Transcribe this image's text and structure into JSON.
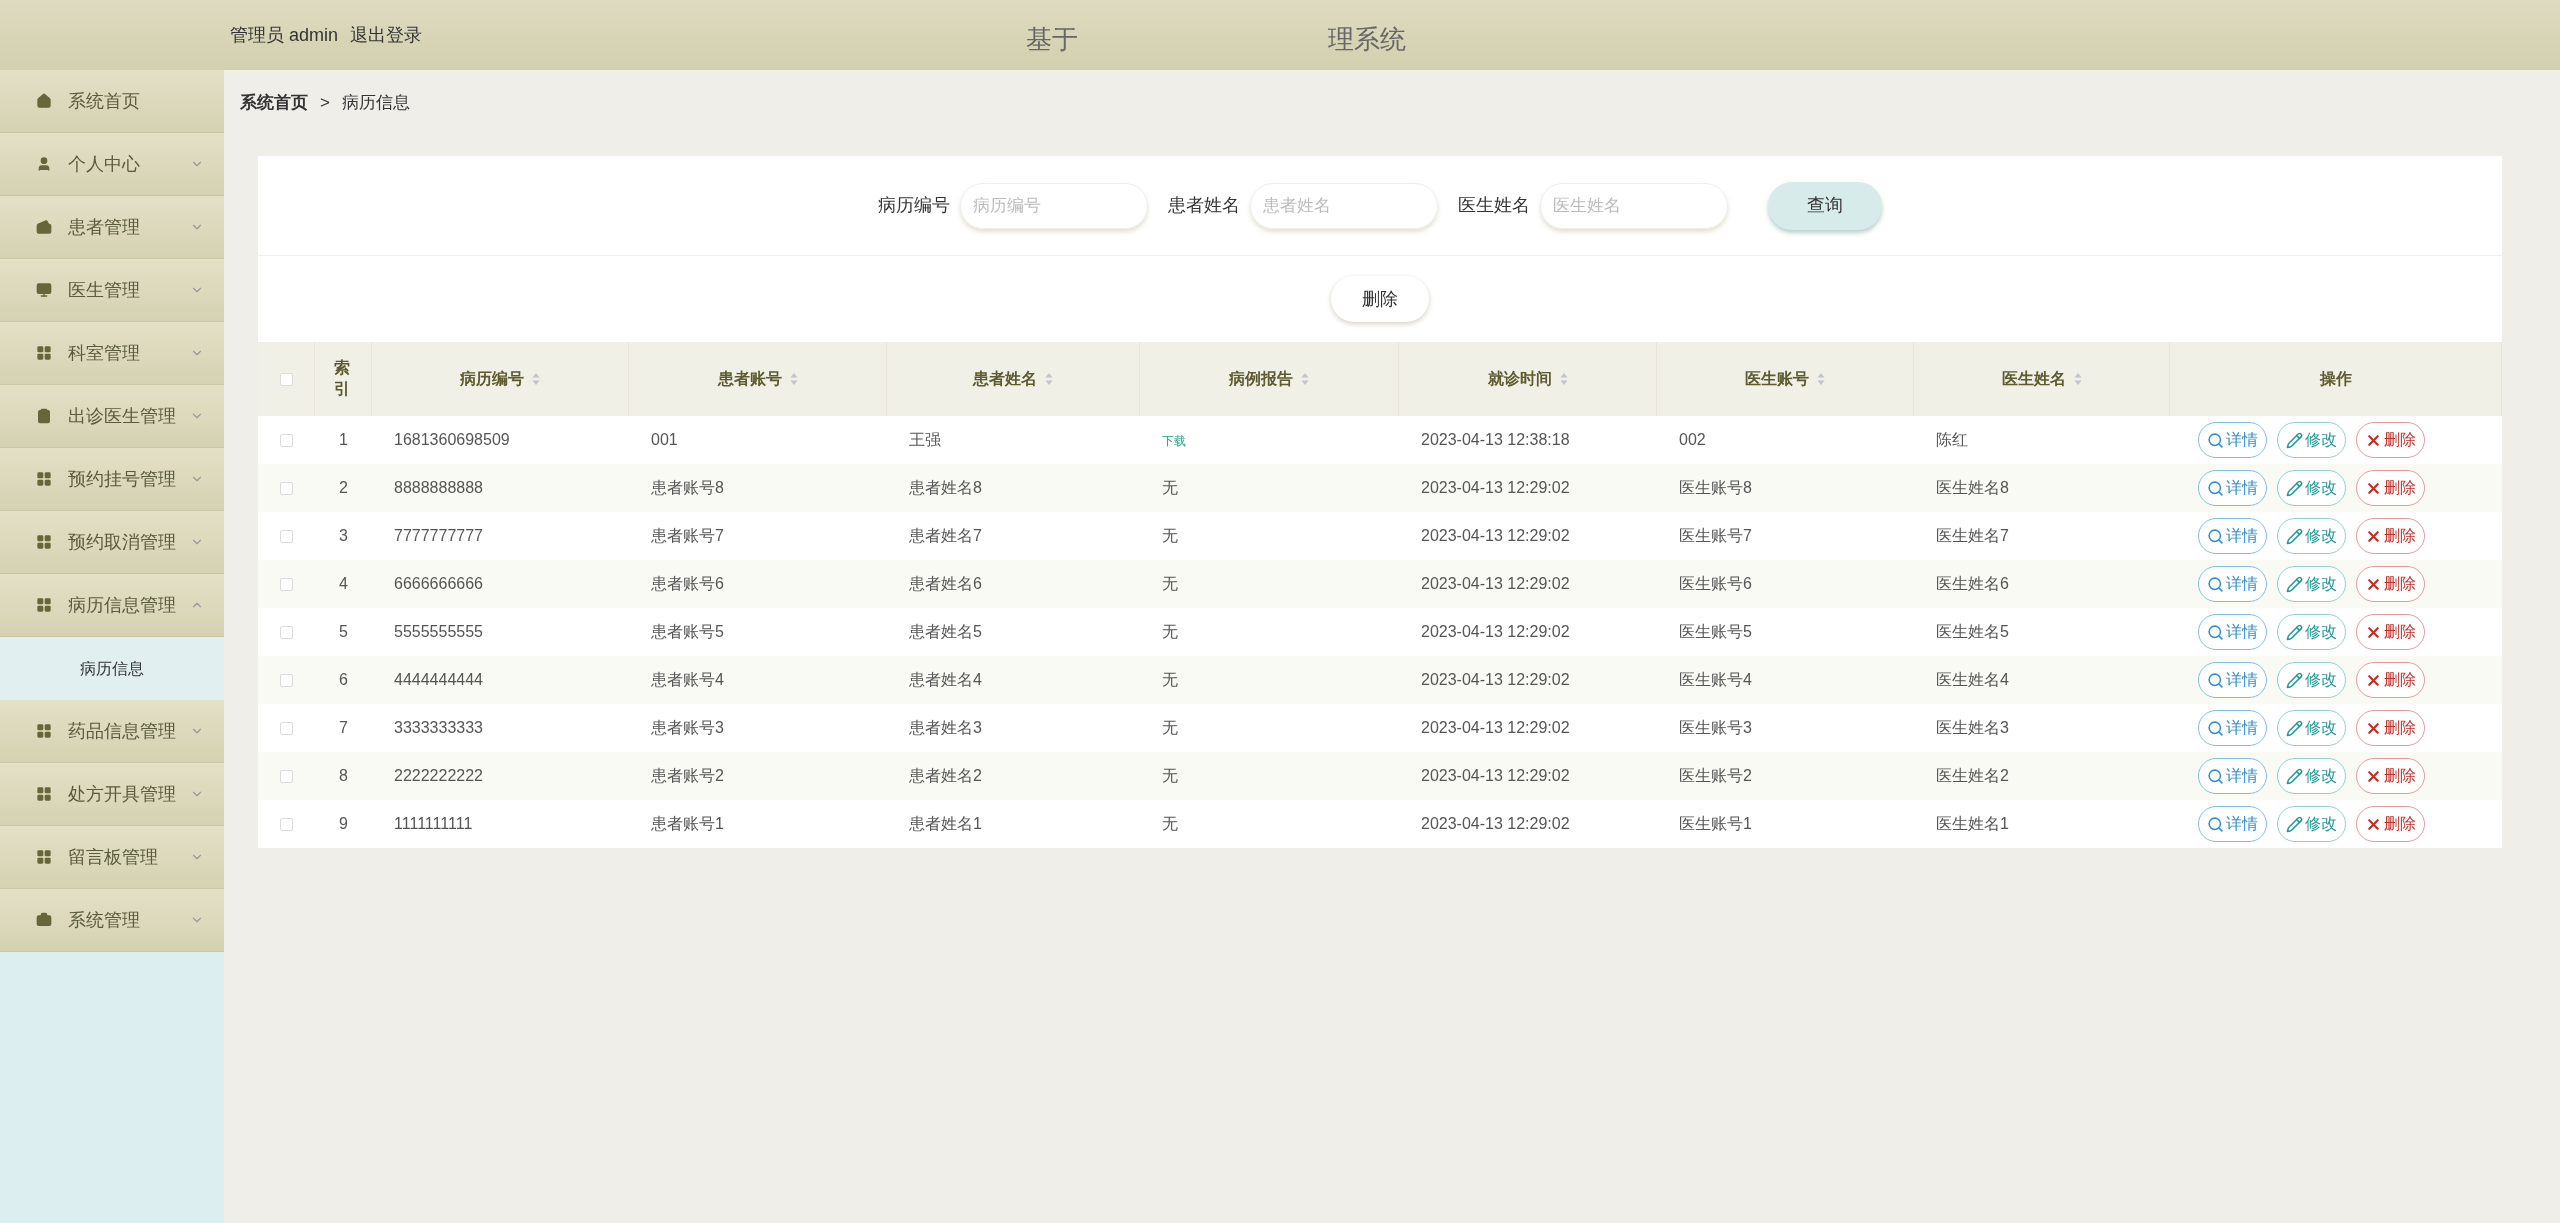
{
  "header": {
    "user": "管理员 admin",
    "logout": "退出登录",
    "title_start": "基于",
    "title_end": "理系统"
  },
  "sidebar": {
    "items": [
      {
        "label": "系统首页",
        "expandable": false,
        "expanded": false
      },
      {
        "label": "个人中心",
        "expandable": true,
        "expanded": false
      },
      {
        "label": "患者管理",
        "expandable": true,
        "expanded": false
      },
      {
        "label": "医生管理",
        "expandable": true,
        "expanded": false
      },
      {
        "label": "科室管理",
        "expandable": true,
        "expanded": false
      },
      {
        "label": "出诊医生管理",
        "expandable": true,
        "expanded": false
      },
      {
        "label": "预约挂号管理",
        "expandable": true,
        "expanded": false
      },
      {
        "label": "预约取消管理",
        "expandable": true,
        "expanded": false
      },
      {
        "label": "病历信息管理",
        "expandable": true,
        "expanded": true,
        "children": [
          {
            "label": "病历信息",
            "selected": true
          }
        ]
      },
      {
        "label": "药品信息管理",
        "expandable": true,
        "expanded": false
      },
      {
        "label": "处方开具管理",
        "expandable": true,
        "expanded": false
      },
      {
        "label": "留言板管理",
        "expandable": true,
        "expanded": false
      },
      {
        "label": "系统管理",
        "expandable": true,
        "expanded": false
      }
    ]
  },
  "breadcrumb": [
    "系统首页",
    ">",
    "病历信息"
  ],
  "search": {
    "fields": [
      {
        "label": "病历编号",
        "placeholder": "病历编号"
      },
      {
        "label": "患者姓名",
        "placeholder": "患者姓名"
      },
      {
        "label": "医生姓名",
        "placeholder": "医生姓名"
      }
    ],
    "button": "查询"
  },
  "toolbar": {
    "delete": "删除"
  },
  "table": {
    "select_all_checked": false,
    "columns": [
      {
        "label": "索引",
        "sortable": false
      },
      {
        "label": "病历编号",
        "sortable": true
      },
      {
        "label": "患者账号",
        "sortable": true
      },
      {
        "label": "患者姓名",
        "sortable": true
      },
      {
        "label": "病例报告",
        "sortable": true
      },
      {
        "label": "就诊时间",
        "sortable": true
      },
      {
        "label": "医生账号",
        "sortable": true
      },
      {
        "label": "医生姓名",
        "sortable": true
      },
      {
        "label": "操作",
        "sortable": false
      }
    ],
    "rows": [
      {
        "checked": false,
        "cells": [
          "1",
          "1681360698509",
          "001",
          "王强",
          {
            "kind": "link",
            "text": "下载"
          },
          "2023-04-13 12:38:18",
          "002",
          "陈红"
        ],
        "actions": [
          {
            "kind": "view",
            "label": "详情"
          },
          {
            "kind": "edit",
            "label": "修改"
          },
          {
            "kind": "delete",
            "label": "删除"
          }
        ]
      },
      {
        "checked": false,
        "cells": [
          "2",
          "8888888888",
          "患者账号8",
          "患者姓名8",
          {
            "kind": "text",
            "text": "无"
          },
          "2023-04-13 12:29:02",
          "医生账号8",
          "医生姓名8"
        ],
        "actions": [
          {
            "kind": "view",
            "label": "详情"
          },
          {
            "kind": "edit",
            "label": "修改"
          },
          {
            "kind": "delete",
            "label": "删除"
          }
        ]
      },
      {
        "checked": false,
        "cells": [
          "3",
          "7777777777",
          "患者账号7",
          "患者姓名7",
          {
            "kind": "text",
            "text": "无"
          },
          "2023-04-13 12:29:02",
          "医生账号7",
          "医生姓名7"
        ],
        "actions": [
          {
            "kind": "view",
            "label": "详情"
          },
          {
            "kind": "edit",
            "label": "修改"
          },
          {
            "kind": "delete",
            "label": "删除"
          }
        ]
      },
      {
        "checked": false,
        "cells": [
          "4",
          "6666666666",
          "患者账号6",
          "患者姓名6",
          {
            "kind": "text",
            "text": "无"
          },
          "2023-04-13 12:29:02",
          "医生账号6",
          "医生姓名6"
        ],
        "actions": [
          {
            "kind": "view",
            "label": "详情"
          },
          {
            "kind": "edit",
            "label": "修改"
          },
          {
            "kind": "delete",
            "label": "删除"
          }
        ]
      },
      {
        "checked": false,
        "cells": [
          "5",
          "5555555555",
          "患者账号5",
          "患者姓名5",
          {
            "kind": "text",
            "text": "无"
          },
          "2023-04-13 12:29:02",
          "医生账号5",
          "医生姓名5"
        ],
        "actions": [
          {
            "kind": "view",
            "label": "详情"
          },
          {
            "kind": "edit",
            "label": "修改"
          },
          {
            "kind": "delete",
            "label": "删除"
          }
        ]
      },
      {
        "checked": false,
        "cells": [
          "6",
          "4444444444",
          "患者账号4",
          "患者姓名4",
          {
            "kind": "text",
            "text": "无"
          },
          "2023-04-13 12:29:02",
          "医生账号4",
          "医生姓名4"
        ],
        "actions": [
          {
            "kind": "view",
            "label": "详情"
          },
          {
            "kind": "edit",
            "label": "修改"
          },
          {
            "kind": "delete",
            "label": "删除"
          }
        ]
      },
      {
        "checked": false,
        "cells": [
          "7",
          "3333333333",
          "患者账号3",
          "患者姓名3",
          {
            "kind": "text",
            "text": "无"
          },
          "2023-04-13 12:29:02",
          "医生账号3",
          "医生姓名3"
        ],
        "actions": [
          {
            "kind": "view",
            "label": "详情"
          },
          {
            "kind": "edit",
            "label": "修改"
          },
          {
            "kind": "delete",
            "label": "删除"
          }
        ]
      },
      {
        "checked": false,
        "cells": [
          "8",
          "2222222222",
          "患者账号2",
          "患者姓名2",
          {
            "kind": "text",
            "text": "无"
          },
          "2023-04-13 12:29:02",
          "医生账号2",
          "医生姓名2"
        ],
        "actions": [
          {
            "kind": "view",
            "label": "详情"
          },
          {
            "kind": "edit",
            "label": "修改"
          },
          {
            "kind": "delete",
            "label": "删除"
          }
        ]
      },
      {
        "checked": false,
        "cells": [
          "9",
          "1111111111",
          "患者账号1",
          "患者姓名1",
          {
            "kind": "text",
            "text": "无"
          },
          "2023-04-13 12:29:02",
          "医生账号1",
          "医生姓名1"
        ],
        "actions": [
          {
            "kind": "view",
            "label": "详情"
          },
          {
            "kind": "edit",
            "label": "修改"
          },
          {
            "kind": "delete",
            "label": "删除"
          }
        ]
      }
    ]
  }
}
